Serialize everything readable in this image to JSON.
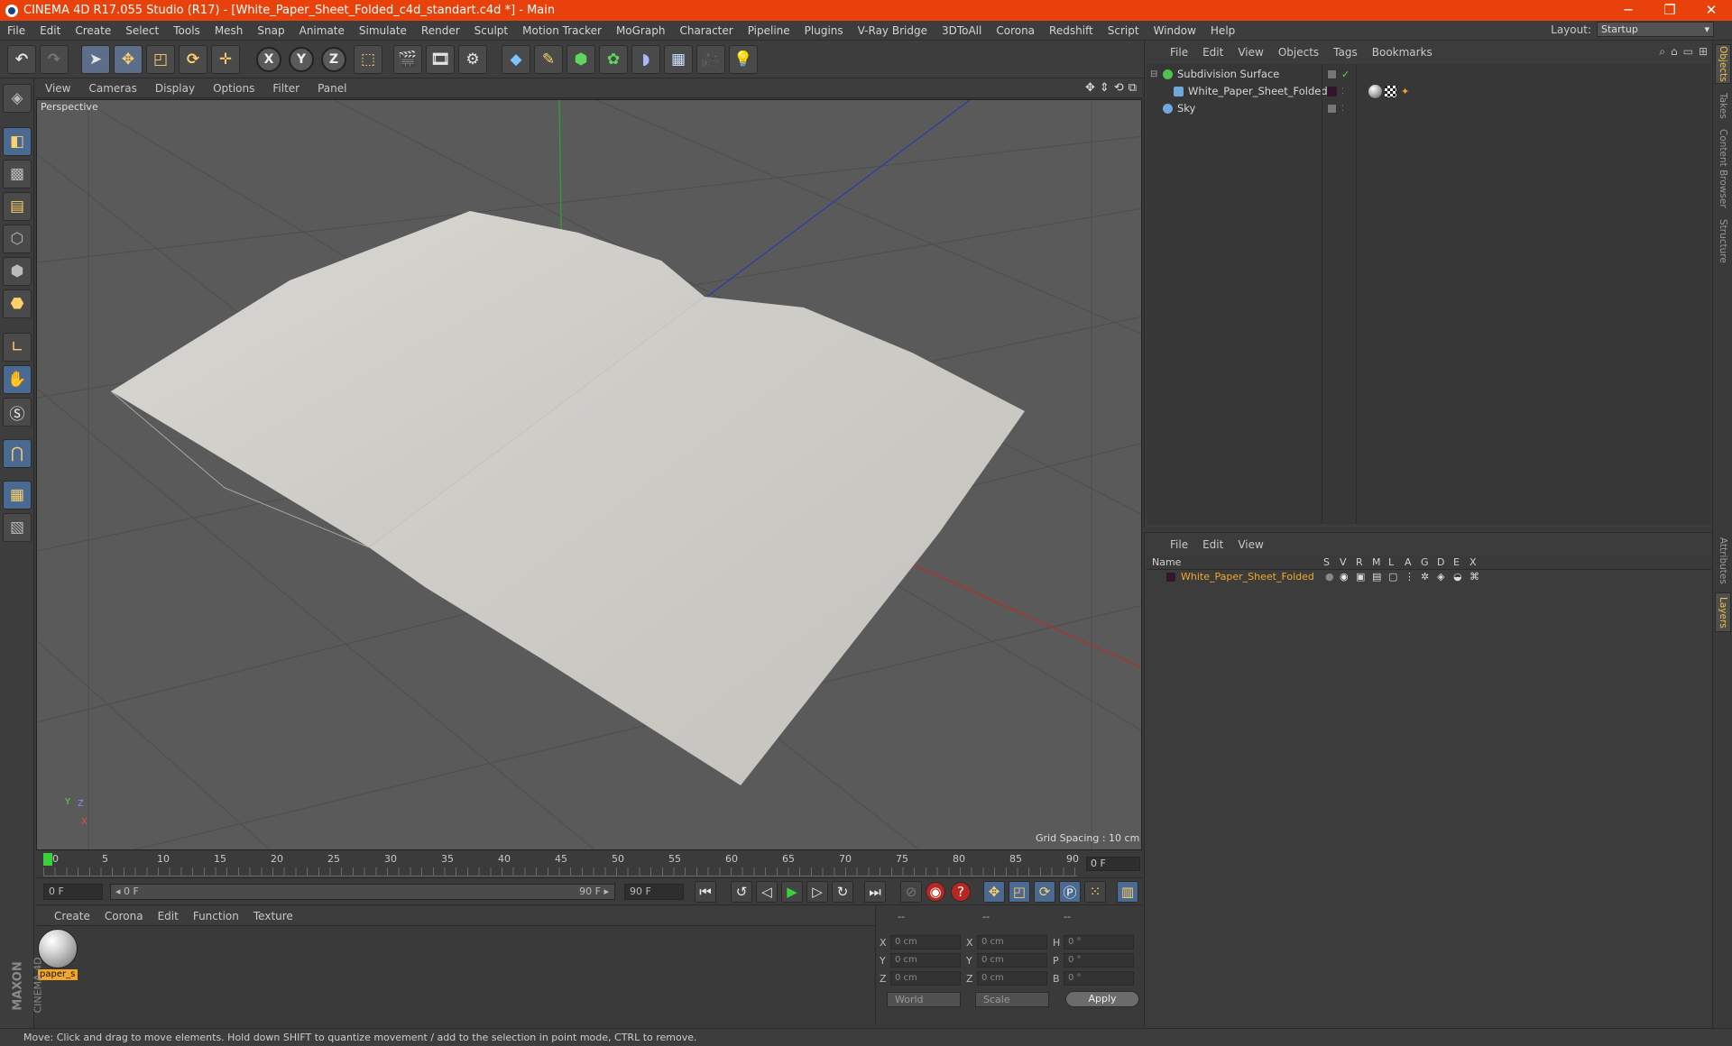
{
  "window": {
    "title": "CINEMA 4D R17.055 Studio (R17) - [White_Paper_Sheet_Folded_c4d_standart.c4d *] - Main",
    "minimize": "─",
    "maximize": "❐",
    "close": "✕"
  },
  "menubar": {
    "items": [
      "File",
      "Edit",
      "Create",
      "Select",
      "Tools",
      "Mesh",
      "Snap",
      "Animate",
      "Simulate",
      "Render",
      "Sculpt",
      "Motion Tracker",
      "MoGraph",
      "Character",
      "Pipeline",
      "Plugins",
      "V-Ray Bridge",
      "3DToAll",
      "Corona",
      "Redshift",
      "Script",
      "Window",
      "Help"
    ],
    "layout_label": "Layout:",
    "layout_value": "Startup"
  },
  "toolbar": {
    "axis_x": "X",
    "axis_y": "Y",
    "axis_z": "Z"
  },
  "viewport": {
    "menu": [
      "View",
      "Cameras",
      "Display",
      "Options",
      "Filter",
      "Panel"
    ],
    "camera_label": "Perspective",
    "grid_spacing": "Grid Spacing : 10 cm",
    "axis_y": "Y",
    "axis_z": "Z",
    "axis_x": "X"
  },
  "timeline": {
    "ticks": [
      "0",
      "5",
      "10",
      "15",
      "20",
      "25",
      "30",
      "35",
      "40",
      "45",
      "50",
      "55",
      "60",
      "65",
      "70",
      "75",
      "80",
      "85",
      "90"
    ],
    "current_frame": "0 F",
    "start_field": "0 F",
    "range_start": "◂ 0 F",
    "range_end": "90 F ▸",
    "end_field": "90 F"
  },
  "material_manager": {
    "menu": [
      "Create",
      "Corona",
      "Edit",
      "Function",
      "Texture"
    ],
    "material_name": "paper_s"
  },
  "coordinates": {
    "headers": [
      "--",
      "--",
      "--"
    ],
    "rows": [
      {
        "l1": "X",
        "v1": "0 cm",
        "l2": "X",
        "v2": "0 cm",
        "l3": "H",
        "v3": "0 °"
      },
      {
        "l1": "Y",
        "v1": "0 cm",
        "l2": "Y",
        "v2": "0 cm",
        "l3": "P",
        "v3": "0 °"
      },
      {
        "l1": "Z",
        "v1": "0 cm",
        "l2": "Z",
        "v2": "0 cm",
        "l3": "B",
        "v3": "0 °"
      }
    ],
    "mode_world": "World",
    "mode_scale": "Scale",
    "apply": "Apply"
  },
  "object_manager": {
    "menu": [
      "File",
      "Edit",
      "View",
      "Objects",
      "Tags",
      "Bookmarks"
    ],
    "objects": [
      {
        "name": "Subdivision Surface",
        "color": "#4fc24f"
      },
      {
        "name": "White_Paper_Sheet_Folded",
        "color": "#6fa8dc"
      },
      {
        "name": "Sky",
        "color": "#6fa8dc"
      }
    ]
  },
  "layer_manager": {
    "menu": [
      "File",
      "Edit",
      "View"
    ],
    "columns": [
      "Name",
      "S",
      "V",
      "R",
      "M",
      "L",
      "A",
      "G",
      "D",
      "E",
      "X"
    ],
    "layer_name": "White_Paper_Sheet_Folded",
    "layer_color": "#f2a72a"
  },
  "side_tabs": [
    "Objects",
    "Takes",
    "Content Browser",
    "Structure",
    "Attributes",
    "Layers"
  ],
  "maxon": {
    "line1": "MAXON",
    "line2": "CINEMA 4D"
  },
  "status": "Move: Click and drag to move elements. Hold down SHIFT to quantize movement / add to the selection in point mode, CTRL to remove."
}
